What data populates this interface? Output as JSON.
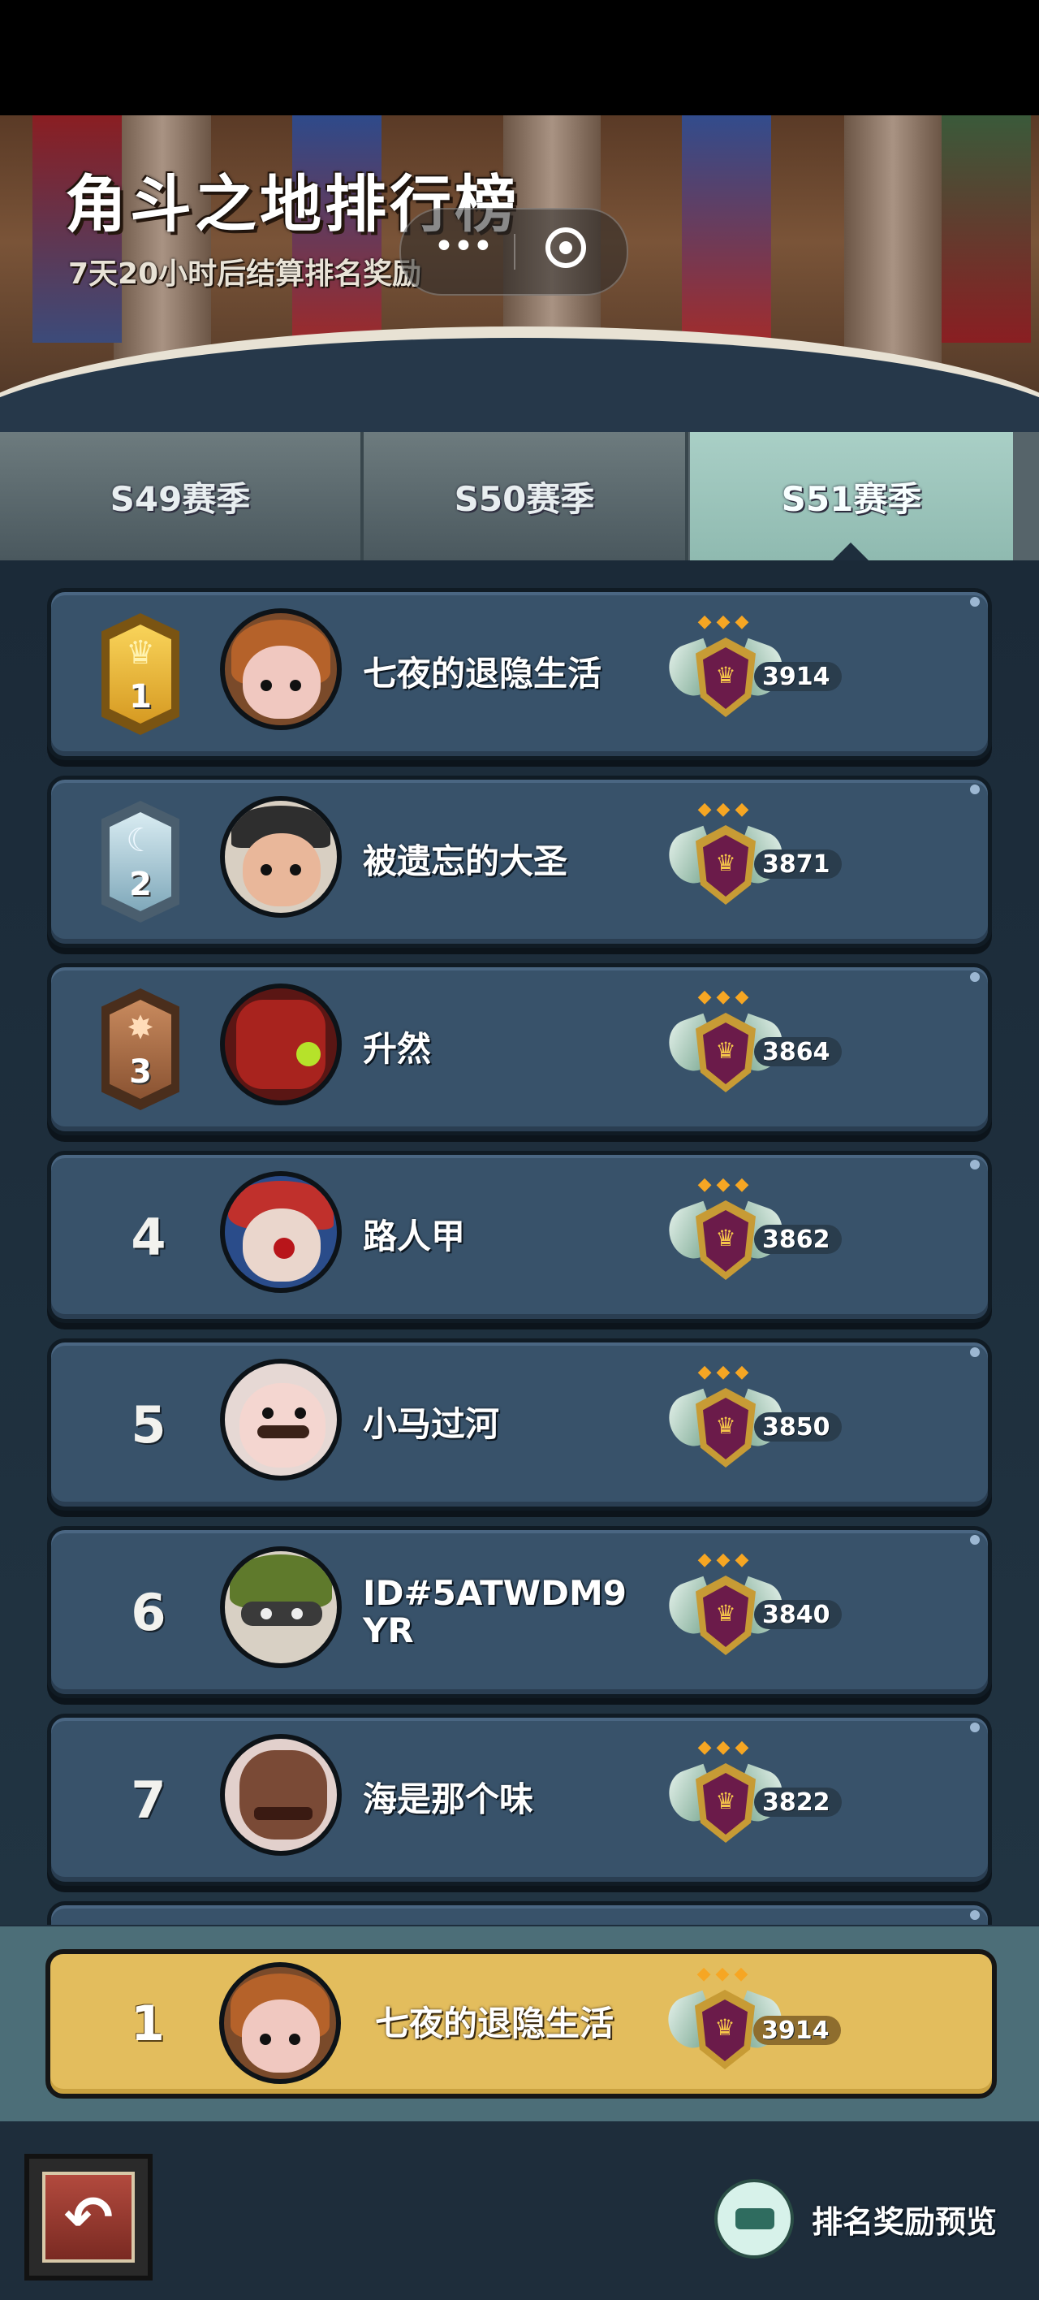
{
  "header": {
    "title": "角斗之地排行榜",
    "subtitle": "7天20小时后结算排名奖励",
    "capsule": {
      "more_icon": "more-dots-icon",
      "close_icon": "target-circle-icon"
    }
  },
  "tabs": [
    {
      "label": "S49赛季",
      "active": false
    },
    {
      "label": "S50赛季",
      "active": false
    },
    {
      "label": "S51赛季",
      "active": true
    }
  ],
  "rankings": [
    {
      "rank": "1",
      "name": "七夜的退隐生活",
      "score": "3914",
      "badge": "gold-crown-badge"
    },
    {
      "rank": "2",
      "name": "被遗忘的大圣",
      "score": "3871",
      "badge": "silver-moon-badge"
    },
    {
      "rank": "3",
      "name": "升然",
      "score": "3864",
      "badge": "bronze-star-badge"
    },
    {
      "rank": "4",
      "name": "路人甲",
      "score": "3862"
    },
    {
      "rank": "5",
      "name": "小马过河",
      "score": "3850"
    },
    {
      "rank": "6",
      "name": "ID#5ATWDM9YR",
      "score": "3840"
    },
    {
      "rank": "7",
      "name": "海是那个味",
      "score": "3822"
    }
  ],
  "my_rank": {
    "rank": "1",
    "name": "七夜的退隐生活",
    "score": "3914"
  },
  "bottom": {
    "back_icon": "back-arrow-icon",
    "reward_preview_label": "排名奖励预览"
  },
  "colors": {
    "row_bg": "#38526a",
    "my_row_bg": "#e3bd5d",
    "active_tab": "#a9cfc6",
    "star": "#f6a623"
  }
}
